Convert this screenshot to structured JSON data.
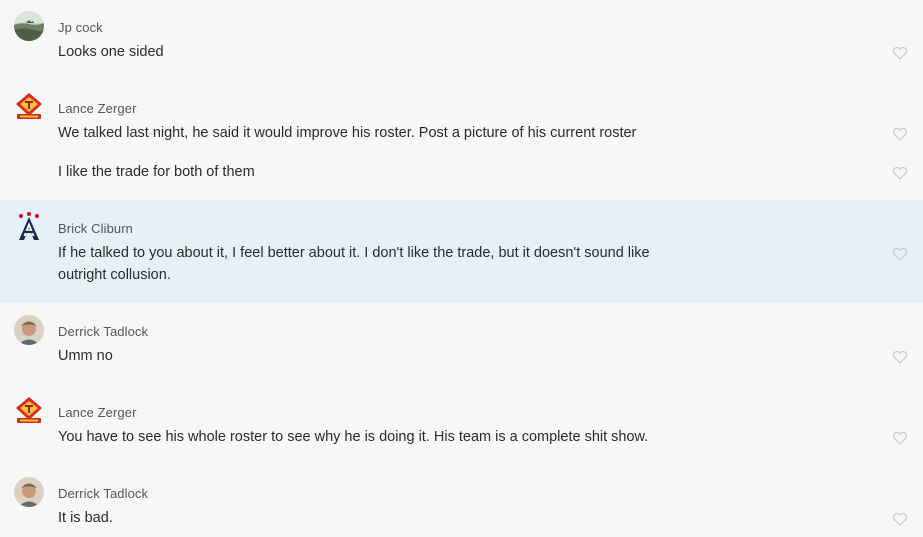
{
  "messages": [
    {
      "author": "Jp cock",
      "avatar": "landscape-photo-avatar",
      "texts": [
        "Looks one sided"
      ]
    },
    {
      "author": "Lance Zerger",
      "avatar": "red-team-logo-avatar",
      "texts": [
        "We talked last night, he said it would improve his roster. Post a picture of his current roster",
        "I like the trade for both of them"
      ]
    },
    {
      "author": "Brick Cliburn",
      "avatar": "blue-a-logo-avatar",
      "texts": [
        "If he talked to you about it, I feel better about it. I don't like the trade, but it doesn't sound like outright collusion."
      ],
      "highlighted": true
    },
    {
      "author": "Derrick Tadlock",
      "avatar": "person-photo-avatar",
      "texts": [
        "Umm no"
      ]
    },
    {
      "author": "Lance Zerger",
      "avatar": "red-team-logo-avatar",
      "texts": [
        "You have to see his whole roster to see why he is doing it. His team is a complete shit show."
      ]
    },
    {
      "author": "Derrick Tadlock",
      "avatar": "person-photo-avatar",
      "texts": [
        "It is bad."
      ]
    }
  ],
  "icons": {
    "like": "heart-outline-icon"
  },
  "colors": {
    "background": "#f7f7f7",
    "highlight": "#e5f0f8",
    "heart": "#c8c8c8",
    "author": "#555555",
    "text": "#2b2b2b"
  }
}
